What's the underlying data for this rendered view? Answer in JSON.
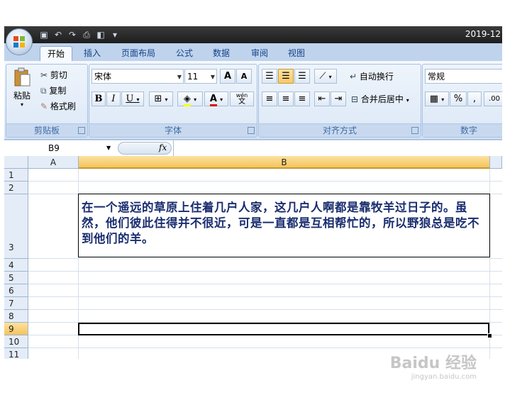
{
  "title": "2019-12",
  "tabs": [
    "开始",
    "插入",
    "页面布局",
    "公式",
    "数据",
    "审阅",
    "视图"
  ],
  "clipboard": {
    "paste": "粘贴",
    "cut": "剪切",
    "copy": "复制",
    "format_painter": "格式刷",
    "label": "剪贴板"
  },
  "font": {
    "name": "宋体",
    "size": "11",
    "grow": "A",
    "shrink": "A",
    "bold": "B",
    "italic": "I",
    "underline": "U",
    "phonetic": "wén",
    "phonetic_char": "文",
    "fill_label": "A",
    "label": "字体"
  },
  "alignment": {
    "wrap_text": "自动换行",
    "merge_center": "合并后居中",
    "label": "对齐方式"
  },
  "number": {
    "format": "常规",
    "percent": "%",
    "comma": ",",
    "decimals": ".00",
    "label": "数字"
  },
  "formula_bar": {
    "name_box": "B9",
    "fx": "fx",
    "content": ""
  },
  "columns": [
    "A",
    "B"
  ],
  "rows": [
    "1",
    "2",
    "3",
    "4",
    "5",
    "6",
    "7",
    "8",
    "9",
    "10",
    "11"
  ],
  "cell_b3": "在一个遥远的草原上住着几户人家，这几户人啊都是靠牧羊过日子的。虽然，他们彼此住得并不很近，可是一直都是互相帮忙的，所以野狼总是吃不到他们的羊。",
  "watermark": {
    "brand": "Baidu 经验",
    "url": "jingyan.baidu.com"
  }
}
